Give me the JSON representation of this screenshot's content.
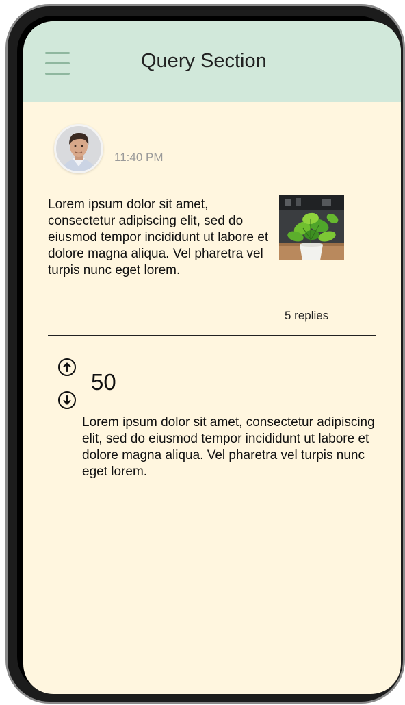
{
  "header": {
    "title": "Query Section",
    "menu_icon": "hamburger-menu-icon",
    "background": "#d1e8da"
  },
  "post": {
    "timestamp": "11:40 PM",
    "body": "Lorem ipsum dolor sit amet, consectetur adipiscing elit, sed do eiusmod tempor incididunt ut labore et dolore magna aliqua. Vel pharetra vel turpis nunc eget lorem.",
    "replies": "5 replies"
  },
  "reply": {
    "upvote_icon": "arrow-up-circle-icon",
    "downvote_icon": "arrow-down-circle-icon",
    "votes": "50",
    "body": "Lorem ipsum dolor sit amet, consectetur adipiscing elit, sed do eiusmod tempor incididunt ut labore et dolore magna aliqua. Vel pharetra vel turpis nunc eget lorem."
  },
  "colors": {
    "screen_background": "#fff6df",
    "header_background": "#d1e8da",
    "menu_icon": "#8fb79f"
  }
}
